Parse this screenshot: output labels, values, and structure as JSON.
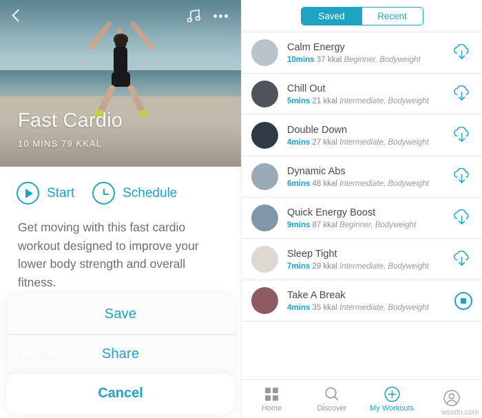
{
  "left": {
    "hero": {
      "back_icon": "back-chevron-icon",
      "music_icon": "music-note-icon",
      "more_icon": "more-dots-icon",
      "title": "Fast Cardio",
      "subtitle": "10 MINS   79 KKAL"
    },
    "actions": [
      {
        "label": "Start",
        "icon": "play-icon"
      },
      {
        "label": "Schedule",
        "icon": "clock-icon"
      }
    ],
    "description": "Get moving with this fast cardio workout designed to improve your lower body strength and overall fitness.",
    "partial_text": "Full Body",
    "action_sheet": {
      "items": [
        "Save",
        "Share"
      ],
      "cancel": "Cancel"
    }
  },
  "right": {
    "segments": [
      {
        "label": "Saved",
        "active": true
      },
      {
        "label": "Recent",
        "active": false
      }
    ],
    "workouts": [
      {
        "title": "Calm Energy",
        "mins": "10mins",
        "kkal": "37 kkal",
        "tags": "Beginner, Bodyweight",
        "action": "download-icon",
        "thumb": "#b9c4c9"
      },
      {
        "title": "Chill Out",
        "mins": "5mins",
        "kkal": "21 kkal",
        "tags": "Intermediate, Bodyweight",
        "action": "download-icon",
        "thumb": "#4e5459"
      },
      {
        "title": "Double Down",
        "mins": "4mins",
        "kkal": "27 kkal",
        "tags": "Intermediate, Bodyweight",
        "action": "download-icon",
        "thumb": "#2f3a46"
      },
      {
        "title": "Dynamic Abs",
        "mins": "6mins",
        "kkal": "48 kkal",
        "tags": "Intermediate, Bodyweight",
        "action": "download-icon",
        "thumb": "#9aaab4"
      },
      {
        "title": "Quick Energy Boost",
        "mins": "9mins",
        "kkal": "87 kkal",
        "tags": "Beginner, Bodyweight",
        "action": "download-icon",
        "thumb": "#7f97a8"
      },
      {
        "title": "Sleep Tight",
        "mins": "7mins",
        "kkal": "29 kkal",
        "tags": "Intermediate, Bodyweight",
        "action": "download-icon",
        "thumb": "#ded8d2"
      },
      {
        "title": "Take A Break",
        "mins": "4mins",
        "kkal": "35 kkal",
        "tags": "Intermediate, Bodyweight",
        "action": "stop-icon",
        "thumb": "#8e5b63"
      }
    ],
    "tabs": [
      {
        "label": "Home",
        "icon": "grid-icon",
        "active": false
      },
      {
        "label": "Discover",
        "icon": "search-icon",
        "active": false
      },
      {
        "label": "My Workouts",
        "icon": "plus-circle-icon",
        "active": true
      },
      {
        "label": "",
        "icon": "person-icon",
        "active": false
      }
    ]
  },
  "watermark": "wsxdn.com",
  "colors": {
    "accent": "#1fa3c4",
    "muted": "#9a9a9f",
    "text": "#4a4a4f"
  }
}
